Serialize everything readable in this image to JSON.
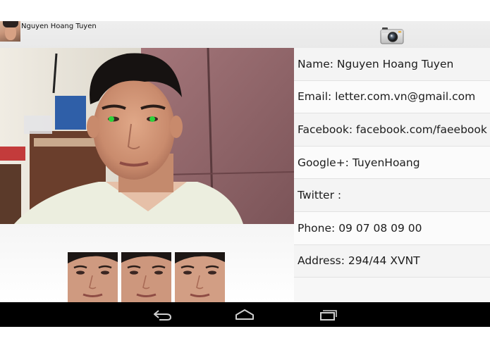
{
  "header": {
    "user_name": "Nguyen Hoang Tuyen",
    "avatar_icon": "face-avatar-icon",
    "camera_icon": "camera-icon"
  },
  "camera_view": {
    "detected_eye_marker_color": "#2fd13a"
  },
  "thumbnails": [
    {
      "name": "face-thumbnail-1"
    },
    {
      "name": "face-thumbnail-2"
    },
    {
      "name": "face-thumbnail-3"
    }
  ],
  "contact": {
    "rows": [
      {
        "label": "Name:",
        "value": "Nguyen Hoang Tuyen"
      },
      {
        "label": "Email:",
        "value": "letter.com.vn@gmail.com"
      },
      {
        "label": "Facebook:",
        "value": "facebook.com/faeebook"
      },
      {
        "label": "Google+:",
        "value": "TuyenHoang"
      },
      {
        "label": "Twitter :",
        "value": ""
      },
      {
        "label": "Phone:",
        "value": "09 07 08 09 00"
      },
      {
        "label": "Address:",
        "value": "294/44 XVNT"
      }
    ]
  },
  "navbar": {
    "back_icon": "back-icon",
    "home_icon": "home-icon",
    "recents_icon": "recent-apps-icon"
  }
}
